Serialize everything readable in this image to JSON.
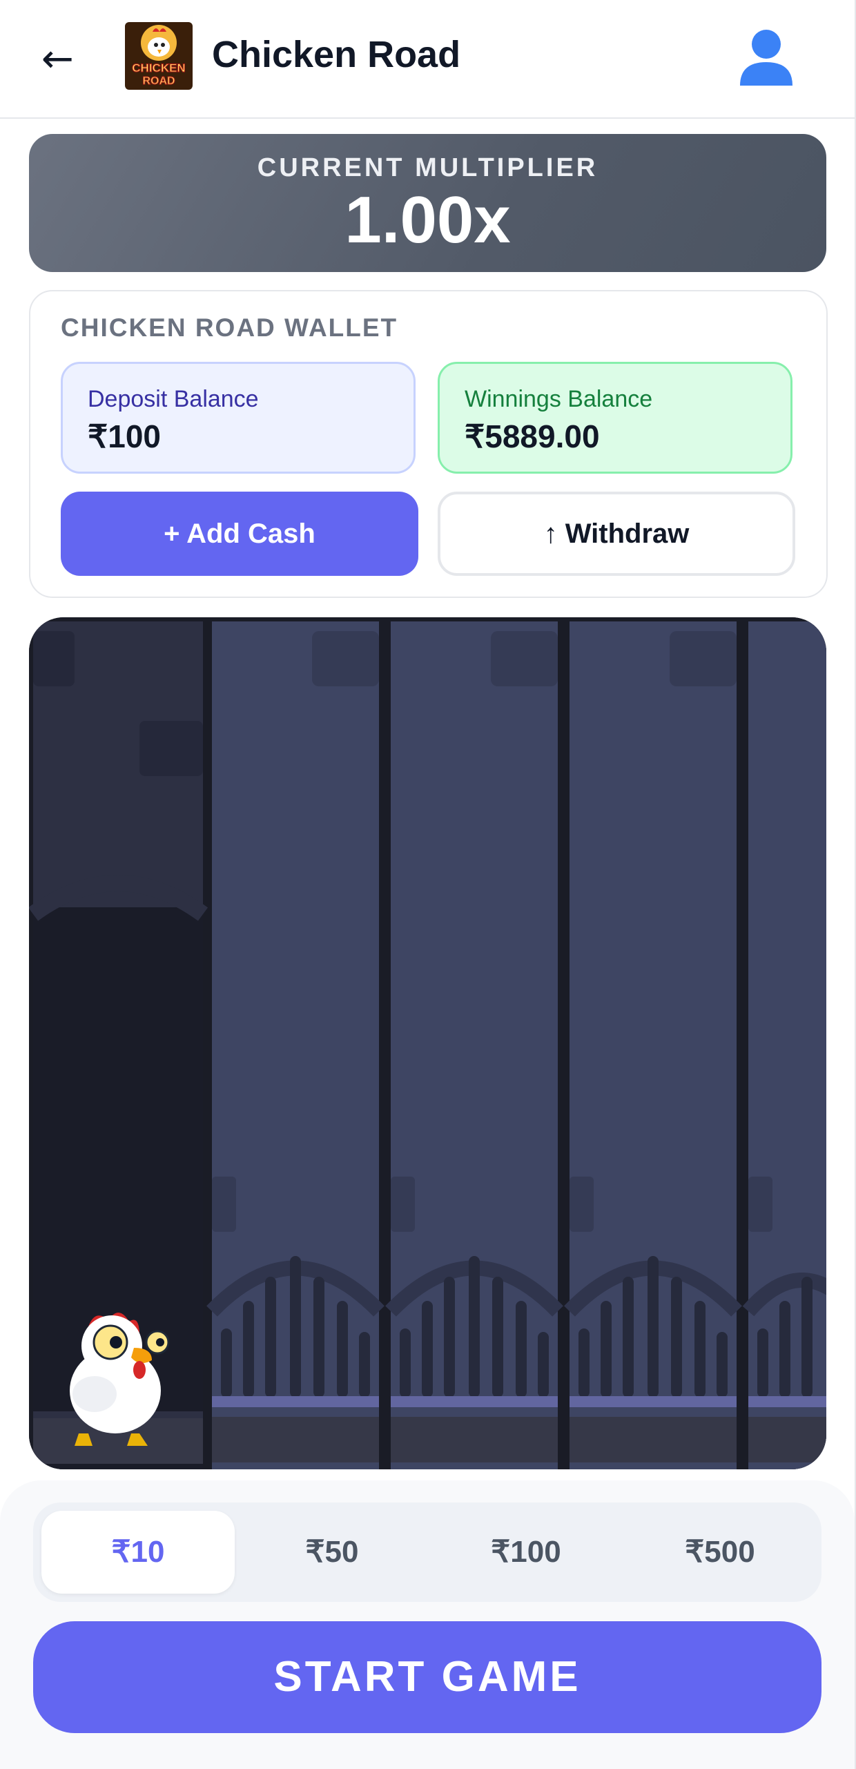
{
  "header": {
    "back_icon": "arrow-left-icon",
    "title": "Chicken Road",
    "logo_text_line1": "CHICKEN",
    "logo_text_line2": "ROAD",
    "profile_icon": "user-icon"
  },
  "multiplier": {
    "label": "CURRENT MULTIPLIER",
    "value": "1.00x"
  },
  "wallet": {
    "title": "CHICKEN ROAD WALLET",
    "deposit_label": "Deposit Balance",
    "deposit_amount": "₹100",
    "winnings_label": "Winnings Balance",
    "winnings_amount": "₹5889.00",
    "add_cash_label": "+ Add Cash",
    "withdraw_label": "↑ Withdraw"
  },
  "bets": {
    "options": [
      "₹10",
      "₹50",
      "₹100",
      "₹500"
    ],
    "selected": "₹10"
  },
  "start_label": "START GAME",
  "colors": {
    "accent": "#6366f1",
    "deposit_bg": "#eef2ff",
    "winnings_bg": "#dcfce7",
    "road": "#3e4563",
    "sidewalk": "#2b2e40"
  }
}
